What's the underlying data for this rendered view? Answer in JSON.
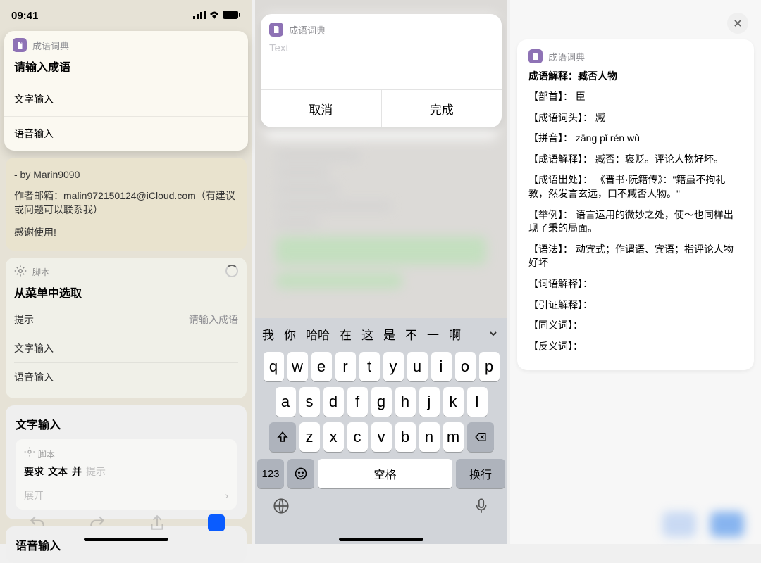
{
  "app_name": "成语词典",
  "screen1": {
    "time": "09:41",
    "sheet_title": "请输入成语",
    "option_text": "文字输入",
    "option_voice": "语音输入",
    "byline": "- by Marin9090",
    "email_line": "作者邮箱：malin972150124@iCloud.com（有建议或问题可以联系我）",
    "thanks": "感谢使用!",
    "script_label": "脚本",
    "menu_title": "从菜单中选取",
    "hint_label": "提示",
    "hint_value": "请输入成语",
    "menu_text": "文字输入",
    "menu_voice": "语音输入",
    "section_text": "文字输入",
    "inner_script": "脚本",
    "req1": "要求",
    "req2": "文本",
    "req3": "并",
    "req_hint": "提示",
    "expand": "展开",
    "section_voice": "语音输入"
  },
  "screen2": {
    "placeholder": "Text",
    "cancel": "取消",
    "done": "完成",
    "candidates": [
      "我",
      "你",
      "哈哈",
      "在",
      "这",
      "是",
      "不",
      "一",
      "啊"
    ],
    "row1": [
      "q",
      "w",
      "e",
      "r",
      "t",
      "y",
      "u",
      "i",
      "o",
      "p"
    ],
    "row2": [
      "a",
      "s",
      "d",
      "f",
      "g",
      "h",
      "j",
      "k",
      "l"
    ],
    "row3": [
      "z",
      "x",
      "c",
      "v",
      "b",
      "n",
      "m"
    ],
    "num_key": "123",
    "space": "空格",
    "return": "换行"
  },
  "screen3": {
    "title": "成语解释：臧否人物",
    "entries": [
      "【部首】： 臣",
      "【成语词头】： 臧",
      "【拼音】： zāng pǐ rén wù",
      "【成语解释】： 臧否：褒贬。评论人物好坏。",
      "【成语出处】： 《晋书·阮籍传》：\"籍虽不拘礼教，然发言玄远，口不臧否人物。\"",
      "【举例】： 语言运用的微妙之处，使～也同样出现了秉的局面。",
      "【语法】： 动宾式；作谓语、宾语；指评论人物好坏",
      "【词语解释】：",
      "【引证解释】：",
      "【同义词】：",
      "【反义词】："
    ]
  }
}
